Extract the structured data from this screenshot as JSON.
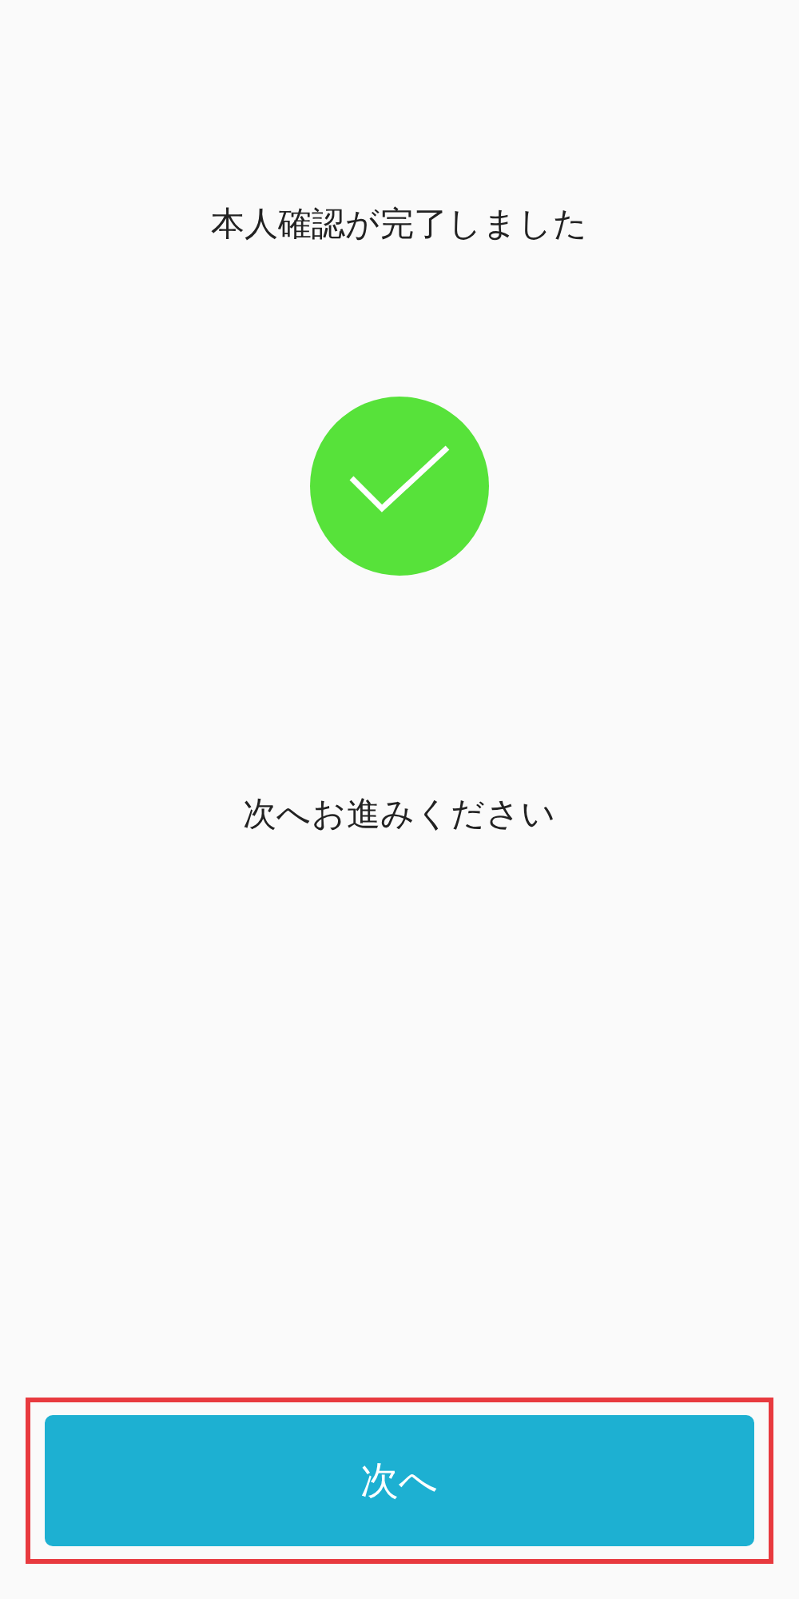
{
  "title": "本人確認が完了しました",
  "status": {
    "kind": "success"
  },
  "message": "次へお進みください",
  "next_button": {
    "label": "次へ",
    "highlighted": true
  }
}
